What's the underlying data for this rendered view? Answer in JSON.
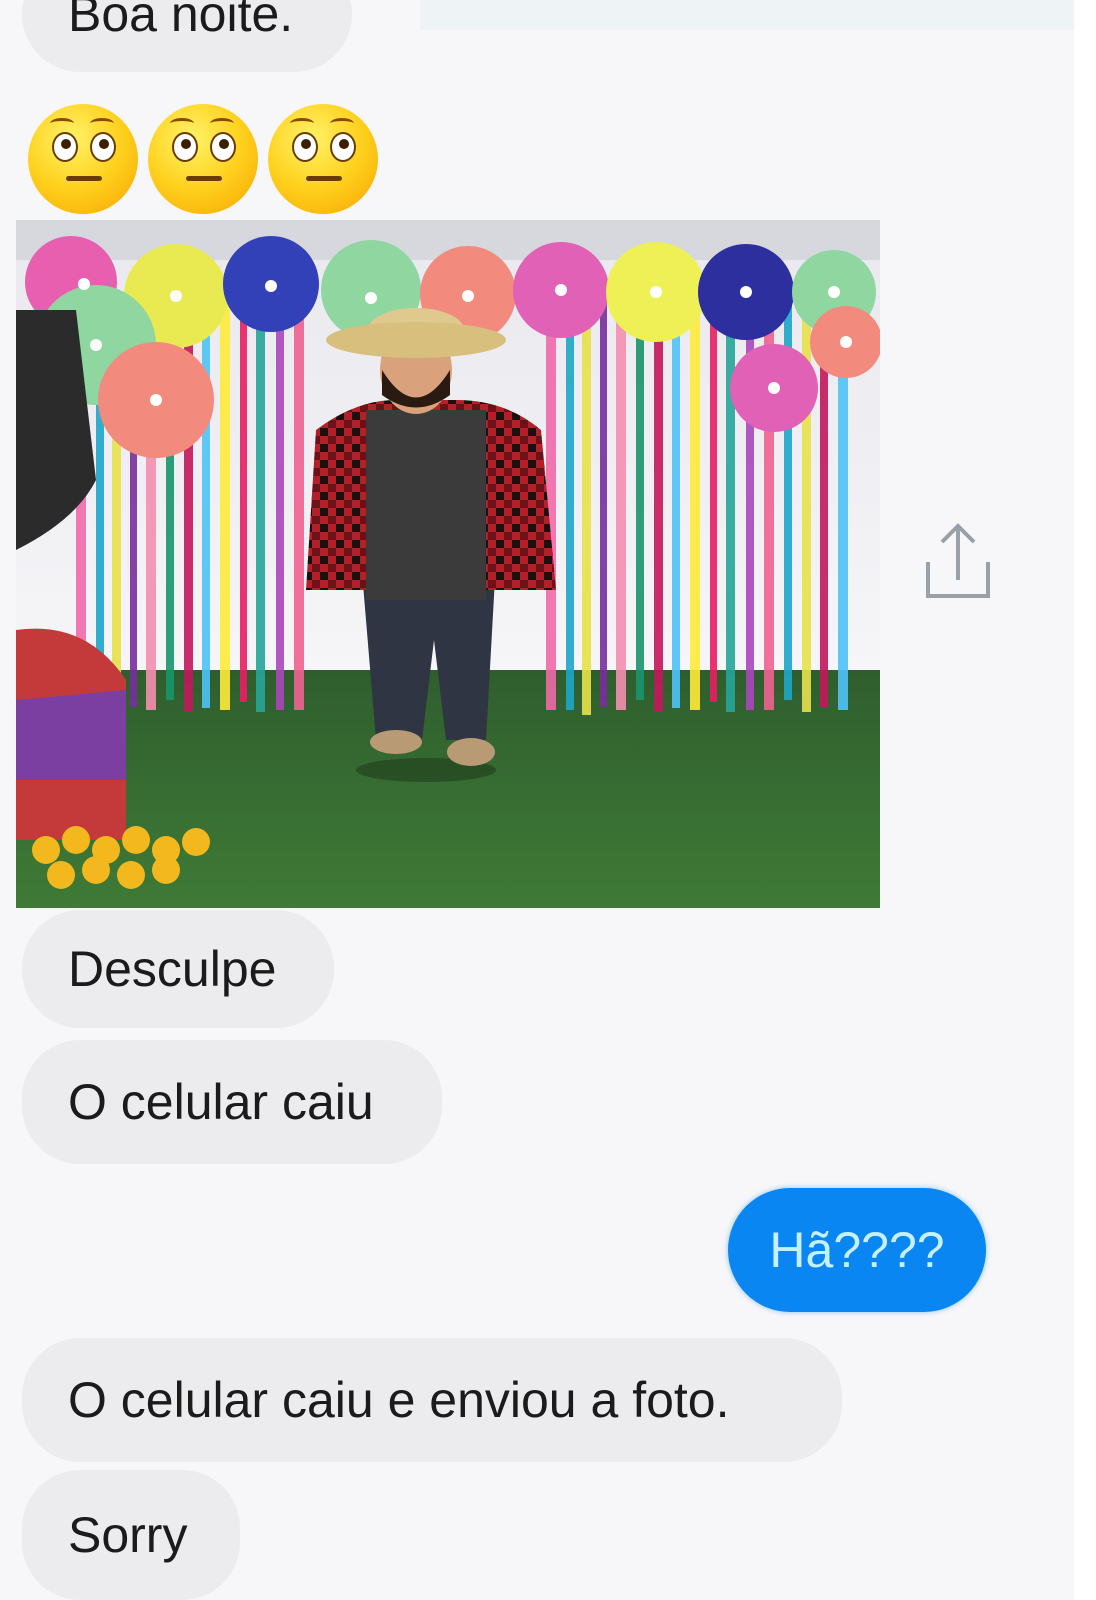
{
  "messages": {
    "greeting": "Boa noite.",
    "emoji_names": [
      "flushed-face-icon",
      "flushed-face-icon",
      "flushed-face-icon"
    ],
    "apology": "Desculpe",
    "phone_fell": "O celular caiu",
    "reply": "Hã????",
    "explanation": "O celular caiu e enviou a foto.",
    "sorry": "Sorry"
  },
  "photo": {
    "subject": "man in straw hat and plaid shirt at a festa junina backdrop"
  },
  "icons": {
    "share": "share-icon"
  },
  "colors": {
    "background": "#f7f7f9",
    "incoming_bubble": "#ececef",
    "outgoing_bubble": "#0a86f3",
    "outgoing_text": "#c4f0ff"
  }
}
